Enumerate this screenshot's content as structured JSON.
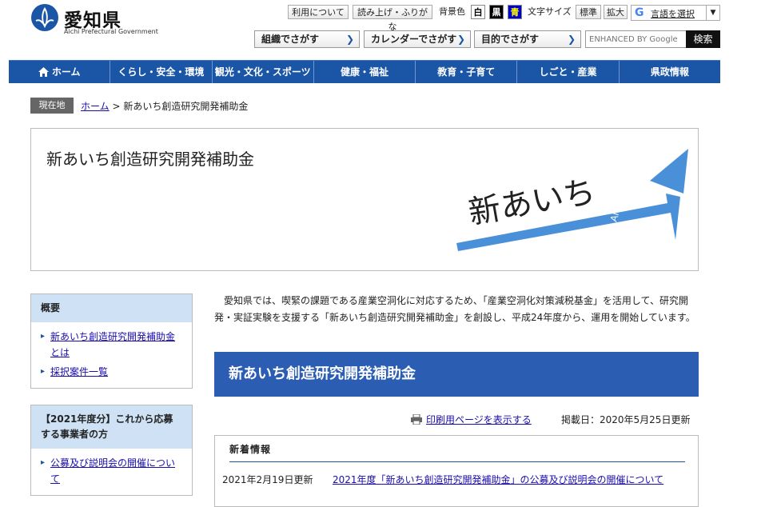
{
  "header": {
    "logo_jp": "愛知県",
    "logo_en": "Aichi Prefectural Government",
    "util_links": [
      "利用について",
      "読み上げ・ふりがな"
    ],
    "bg_color_label": "背景色",
    "bg_options": [
      {
        "label": "白",
        "bg": "#ffffff",
        "fg": "#000000"
      },
      {
        "label": "黒",
        "bg": "#000000",
        "fg": "#ffffff"
      },
      {
        "label": "青",
        "bg": "#0000cc",
        "fg": "#ffff00"
      }
    ],
    "text_size_label": "文字サイズ",
    "text_size_options": [
      "標準",
      "拡大"
    ],
    "translate_label": "言語を選択",
    "nav_buttons": [
      "組織でさがす",
      "カレンダーでさがす",
      "目的でさがす"
    ],
    "search_placeholder": "ENHANCED BY Google",
    "search_button": "検索"
  },
  "global_nav": [
    "ホーム",
    "くらし・安全・環境",
    "観光・文化・スポーツ",
    "健康・福祉",
    "教育・子育て",
    "しごと・産業",
    "県政情報"
  ],
  "breadcrumb": {
    "label": "現在地",
    "home": "ホーム",
    "separator": ">",
    "current": "新あいち創造研究開発補助金"
  },
  "page": {
    "title": "新あいち創造研究開発補助金",
    "banner_text": "新あいち",
    "banner_sub": "AICHI",
    "intro": "愛知県では、喫緊の課題である産業空洞化に対応するため、「産業空洞化対策減税基金」を活用して、研究開発・実証実験を支援する「新あいち創造研究開発補助金」を創設し、平成24年度から、運用を開始しています。",
    "section_banner": "新あいち創造研究開発補助金",
    "print_link": "印刷用ページを表示する",
    "published": "掲載日：2020年5月25日更新"
  },
  "sidebar": [
    {
      "heading": "概要",
      "items": [
        "新あいち創造研究開発補助金とは",
        "採択案件一覧"
      ]
    },
    {
      "heading": "【2021年度分】これから応募する事業者の方",
      "items": [
        "公募及び説明会の開催について"
      ]
    }
  ],
  "news": {
    "title": "新着情報",
    "items": [
      {
        "date": "2021年2月19日更新",
        "text": "2021年度「新あいち創造研究開発補助金」の公募及び説明会の開催について"
      }
    ]
  },
  "colors": {
    "nav_blue": "#1b56a6",
    "section_blue": "#2b5db3",
    "sidebar_head": "#cfe2f5",
    "banner_arrow": "#4a90d9"
  }
}
